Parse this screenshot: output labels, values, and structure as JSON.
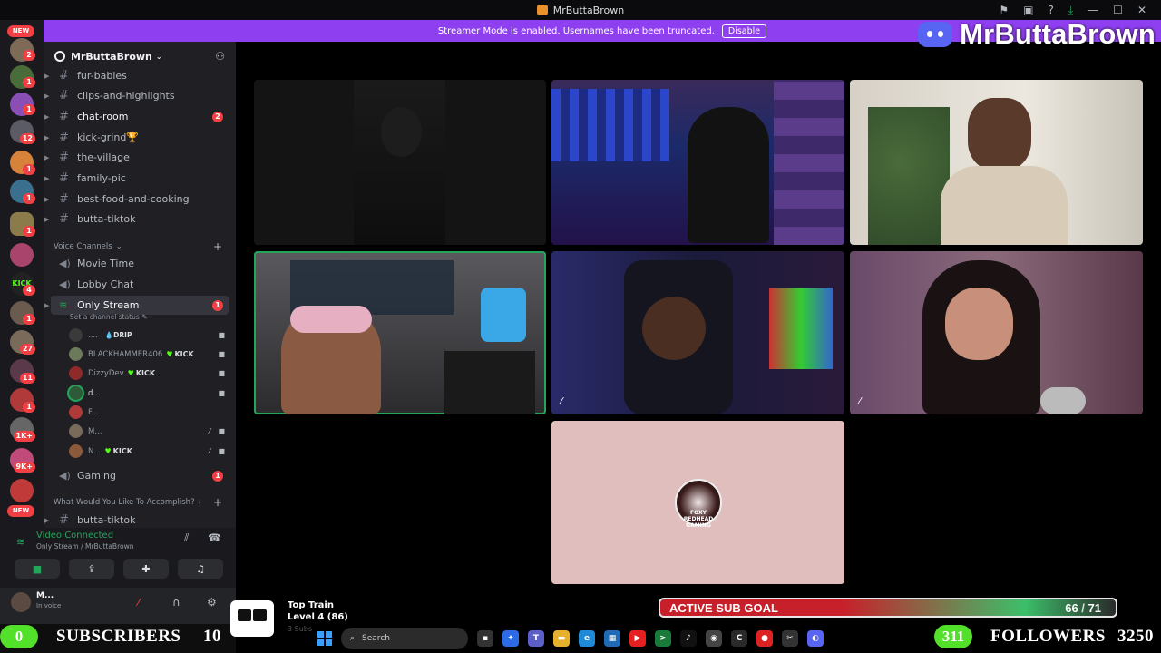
{
  "window": {
    "title": "MrButtaBrown"
  },
  "banner": {
    "message": "Streamer Mode is enabled. Usernames have been truncated.",
    "disable_label": "Disable"
  },
  "brand": {
    "name": "MrButtaBrown"
  },
  "rail": {
    "new_label": "NEW",
    "badges": [
      "2",
      "1",
      "1",
      "12",
      "1",
      "1",
      "1",
      "4",
      "1",
      "27",
      "11",
      "1",
      "1K+",
      "9K+"
    ],
    "bottom_new": "NEW"
  },
  "server": {
    "name": "MrButtaBrown"
  },
  "channels": [
    {
      "name": "fur-babies",
      "count": ""
    },
    {
      "name": "clips-and-highlights",
      "count": ""
    },
    {
      "name": "chat-room",
      "count": "2"
    },
    {
      "name": "kick-grind🏆",
      "count": ""
    },
    {
      "name": "the-village",
      "count": ""
    },
    {
      "name": "family-pic",
      "count": ""
    },
    {
      "name": "best-food-and-cooking",
      "count": ""
    },
    {
      "name": "butta-tiktok",
      "count": ""
    }
  ],
  "voice_category": "Voice Channels",
  "voice_channels": [
    {
      "name": "Movie Time"
    },
    {
      "name": "Lobby Chat"
    },
    {
      "name": "Only Stream",
      "count": "1",
      "status": "Set a channel status"
    }
  ],
  "voice_members": [
    {
      "name": "....",
      "tag": "DRIP",
      "kick": ""
    },
    {
      "name": "BLACKHAMMER406",
      "tag": "",
      "kick": "KICK"
    },
    {
      "name": "DizzyDev",
      "tag": "",
      "kick": "KICK"
    },
    {
      "name": "d...",
      "tag": "",
      "kick": ""
    },
    {
      "name": "F...",
      "tag": "",
      "kick": ""
    },
    {
      "name": "M...",
      "tag": "",
      "kick": ""
    },
    {
      "name": "N...",
      "tag": "",
      "kick": "KICK"
    }
  ],
  "gaming_channel": {
    "name": "Gaming",
    "count": "1"
  },
  "category2": "What Would You Like To Accomplish?",
  "partial_channel": "butta-tiktok",
  "voice_panel": {
    "status": "Video Connected",
    "location": "Only Stream / MrButtaBrown"
  },
  "user_panel": {
    "name": "M...",
    "status": "In voice"
  },
  "tile_logo_text": "FOXY REDHEAD GAMING",
  "overlay": {
    "sub_goal_label": "ACTIVE SUB GOAL",
    "sub_goal_current": "66",
    "sub_goal_sep": " / ",
    "sub_goal_target": "71",
    "sub_goal_fraction": 0.93,
    "subscribers_left_count": "0",
    "subscribers_label": "SUBSCRIBERS",
    "subscribers_count": "10",
    "followers_left_count": "311",
    "followers_label": "FOLLOWERS",
    "followers_count": "3250",
    "train_title": "Top Train",
    "train_level": "Level 4 (86)",
    "train_faint": "3 Subs"
  },
  "taskbar": {
    "search_placeholder": "Search"
  },
  "colors": {
    "accent": "#8e3ff0",
    "speaking": "#23a55a",
    "badge": "#f23f43",
    "kick": "#53fc18"
  }
}
